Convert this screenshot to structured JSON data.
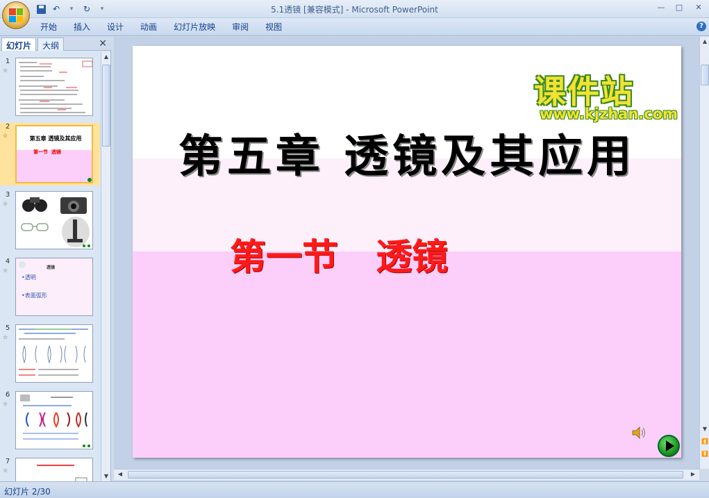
{
  "window": {
    "title": "5.1透镜 [兼容模式] - Microsoft PowerPoint",
    "minimize": "—",
    "maximize": "□",
    "close": "✕"
  },
  "quick_access": {
    "items": [
      "save-icon",
      "undo-icon",
      "redo-icon",
      "customize-icon"
    ]
  },
  "ribbon": {
    "tabs": [
      "开始",
      "插入",
      "设计",
      "动画",
      "幻灯片放映",
      "审阅",
      "视图"
    ],
    "help": "?"
  },
  "left_pane": {
    "tabs": [
      "幻灯片",
      "大纲"
    ],
    "active_tab": 0,
    "close": "✕",
    "slides": [
      {
        "number": "1",
        "anim": "☆"
      },
      {
        "number": "2",
        "anim": "☆",
        "selected": true,
        "title": "第五章 透镜及其应用",
        "subtitle": "第一节  透镜"
      },
      {
        "number": "3",
        "anim": "☆"
      },
      {
        "number": "4",
        "anim": "☆",
        "title": "透镜",
        "items": [
          "•透明",
          "•表面弧形"
        ]
      },
      {
        "number": "5",
        "anim": "☆"
      },
      {
        "number": "6",
        "anim": "☆"
      },
      {
        "number": "7",
        "anim": "☆"
      }
    ]
  },
  "slide": {
    "title": "第五章 透镜及其应用",
    "subtitle": "第一节   透镜",
    "watermark_main": "课件站",
    "watermark_url": "www.kjzhan.com",
    "colors": {
      "title": "#000000",
      "subtitle": "#ff1a1a",
      "watermark": "#f2e234",
      "band_top": "#ffffff",
      "band_mid": "#fdf0fb",
      "band_bottom": "#fccffa"
    }
  },
  "status": {
    "slide_info": "幻灯片 2/30"
  }
}
